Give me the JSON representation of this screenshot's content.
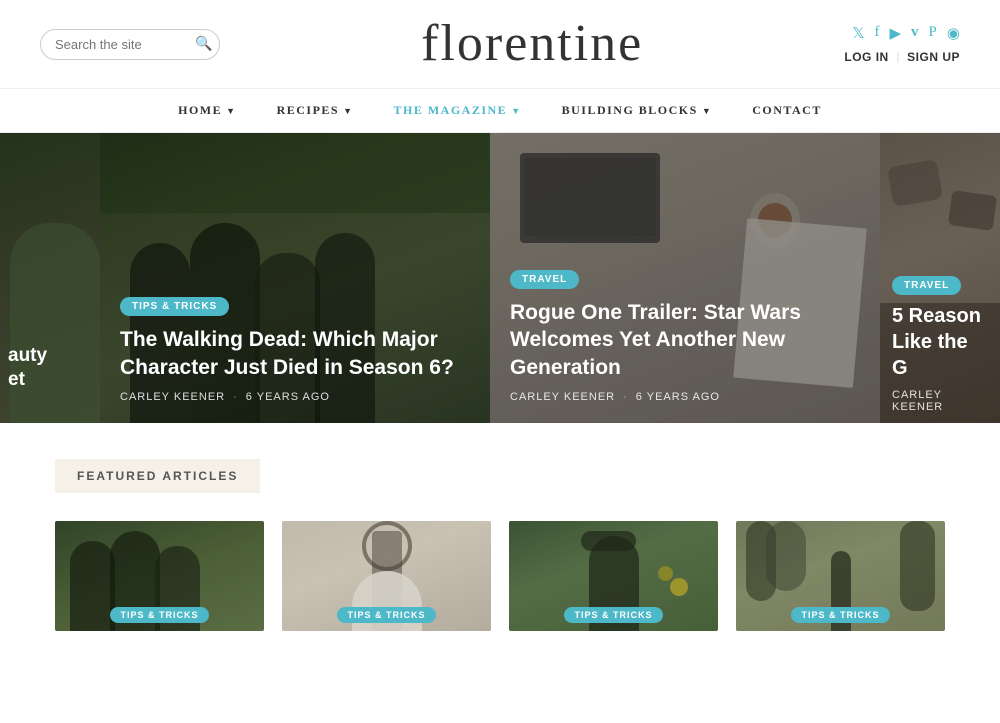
{
  "header": {
    "search_placeholder": "Search the site",
    "logo": "florentine",
    "auth": {
      "login": "LOG IN",
      "divider": "|",
      "signup": "SIGN UP"
    },
    "social": [
      {
        "name": "twitter",
        "icon": "𝕏"
      },
      {
        "name": "facebook",
        "icon": "f"
      },
      {
        "name": "youtube",
        "icon": "▶"
      },
      {
        "name": "vimeo",
        "icon": "v"
      },
      {
        "name": "pinterest",
        "icon": "P"
      },
      {
        "name": "instagram",
        "icon": "◉"
      }
    ]
  },
  "nav": {
    "items": [
      {
        "label": "HOME",
        "active": false,
        "has_dropdown": true
      },
      {
        "label": "RECIPES",
        "active": false,
        "has_dropdown": true
      },
      {
        "label": "THE MAGAZINE",
        "active": true,
        "has_dropdown": true
      },
      {
        "label": "BUILDING BLOCKS",
        "active": false,
        "has_dropdown": true
      },
      {
        "label": "CONTACT",
        "active": false,
        "has_dropdown": false
      }
    ]
  },
  "hero": {
    "slides": [
      {
        "id": "slide-partial-left",
        "badge": null,
        "title": "auty et",
        "author": "",
        "time": "",
        "bg": "partial"
      },
      {
        "id": "slide-walking-dead",
        "badge": "TIPS & TRICKS",
        "title": "The Walking Dead: Which Major Character Just Died in Season 6?",
        "author": "Carley Keener",
        "time": "6 YEARS AGO",
        "bg": "friends"
      },
      {
        "id": "slide-rogue-one",
        "badge": "TRAVEL",
        "title": "Rogue One Trailer: Star Wars Welcomes Yet Another New Generation",
        "author": "Carley Keener",
        "time": "6 YEARS AGO",
        "bg": "desk"
      },
      {
        "id": "slide-right-partial",
        "badge": "TRAVEL",
        "title": "5 Reason Like the G",
        "author": "Carley Keener",
        "time": "",
        "bg": "rocks"
      }
    ]
  },
  "featured": {
    "section_title": "FEATURED ARTICLES",
    "articles": [
      {
        "badge": "TIPS & TRICKS",
        "bg": "card1"
      },
      {
        "badge": "TIPS & TRICKS",
        "bg": "card2"
      },
      {
        "badge": "TIPS & TRICKS",
        "bg": "card3"
      },
      {
        "badge": "TIPS & TRICKS",
        "bg": "card4"
      }
    ]
  }
}
